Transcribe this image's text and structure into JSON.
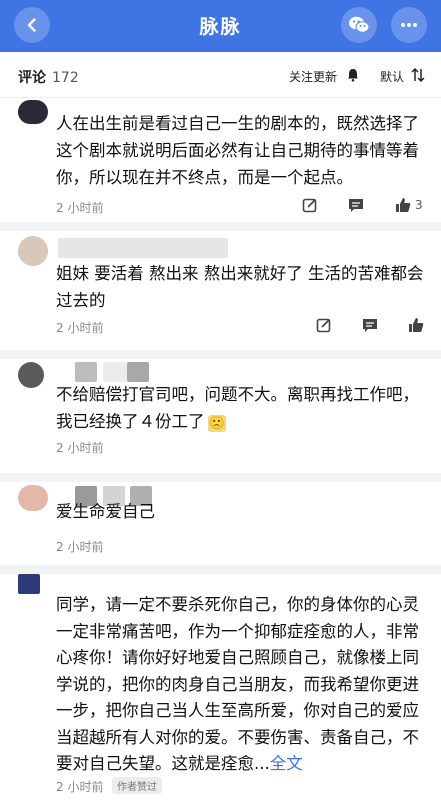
{
  "header": {
    "title": "脉脉"
  },
  "sortbar": {
    "label": "评论",
    "count": "172",
    "follow": "关注更新",
    "default_sort": "默认"
  },
  "comments": [
    {
      "text": "人在出生前是看过自己一生的剧本的，既然选择了这个剧本就说明后面必然有让自己期待的事情等着你，所以现在并不终点，而是一个起点。",
      "time": "2 小时前",
      "likes": "3"
    },
    {
      "text": "姐妹  要活着 熬出来 熬出来就好了 生活的苦难都会过去的",
      "time": "2 小时前",
      "likes": ""
    },
    {
      "text": "不给赔偿打官司吧，问题不大。离职再找工作吧，我已经换了４份工了",
      "emoji": "🙁",
      "time": "2 小时前",
      "likes": ""
    },
    {
      "text": "爱生命爱自己",
      "time": "2 小时前",
      "likes": ""
    },
    {
      "text": "同学，请一定不要杀死你自己，你的身体你的心灵一定非常痛苦吧，作为一个抑郁症痊愈的人，非常心疼你！请你好好地爱自己照顾自己，就像楼上同学说的，把你的肉身自己当朋友，而我希望你更进一步，把你自己当人生至高所爱，你对自己的爱应当超越所有人对你的爱。不要伤害、责备自己，不要对自己失望。这就是痊愈...",
      "more": "全文",
      "time": "2 小时前",
      "badge": "作者赞过",
      "likes": ""
    }
  ]
}
